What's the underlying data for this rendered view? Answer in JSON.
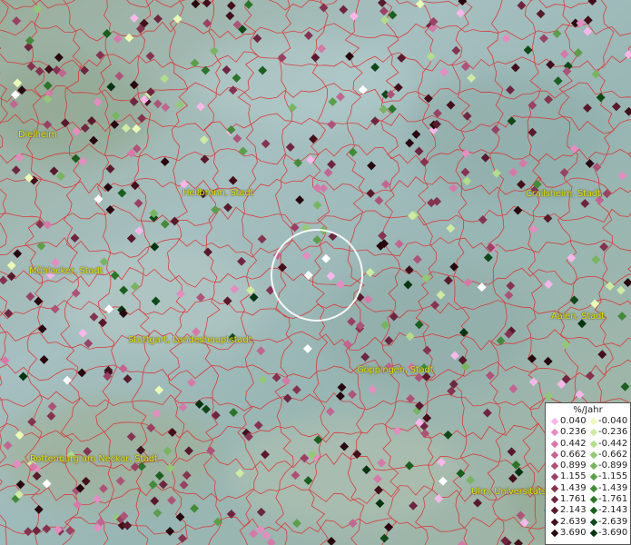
{
  "map": {
    "background": "#9fb8b0",
    "boundary_color": "#e02020",
    "selection_circle": true
  },
  "cities": [
    {
      "label": "Dielheim"
    },
    {
      "label": "Heilbronn, Stadt"
    },
    {
      "label": "Crailsheim, Stadt"
    },
    {
      "label": "Mühlacker, Stadt"
    },
    {
      "label": "Aalen, Stadt"
    },
    {
      "label": "Stuttgart, Landeshauptstadt"
    },
    {
      "label": "Göppingen, Stadt"
    },
    {
      "label": "Rottenburg am Neckar, Stadt"
    },
    {
      "label": "Ulm, Universitätsstadt"
    }
  ],
  "legend": {
    "title": "%/Jahr",
    "positive": [
      {
        "label": "0.040",
        "color": "#f6b8e8"
      },
      {
        "label": "0.236",
        "color": "#e28ec0"
      },
      {
        "label": "0.442",
        "color": "#d47aa8"
      },
      {
        "label": "0.662",
        "color": "#c06690"
      },
      {
        "label": "0.899",
        "color": "#ac5478"
      },
      {
        "label": "1.155",
        "color": "#984264"
      },
      {
        "label": "1.439",
        "color": "#843450"
      },
      {
        "label": "1.761",
        "color": "#6e2640"
      },
      {
        "label": "2.143",
        "color": "#581a2c"
      },
      {
        "label": "2.639",
        "color": "#42101c"
      },
      {
        "label": "3.690",
        "color": "#280810"
      }
    ],
    "negative": [
      {
        "label": "-0.040",
        "color": "#eafab8"
      },
      {
        "label": "-0.236",
        "color": "#cfeaa4"
      },
      {
        "label": "-0.442",
        "color": "#b2dc8e"
      },
      {
        "label": "-0.662",
        "color": "#94c878"
      },
      {
        "label": "-0.899",
        "color": "#78b462"
      },
      {
        "label": "-1.155",
        "color": "#5c9e4c"
      },
      {
        "label": "-1.439",
        "color": "#448a3a"
      },
      {
        "label": "-1.761",
        "color": "#2c742a"
      },
      {
        "label": "-2.143",
        "color": "#1c5e20"
      },
      {
        "label": "-2.639",
        "color": "#104818"
      },
      {
        "label": "-3.690",
        "color": "#063410"
      }
    ]
  }
}
